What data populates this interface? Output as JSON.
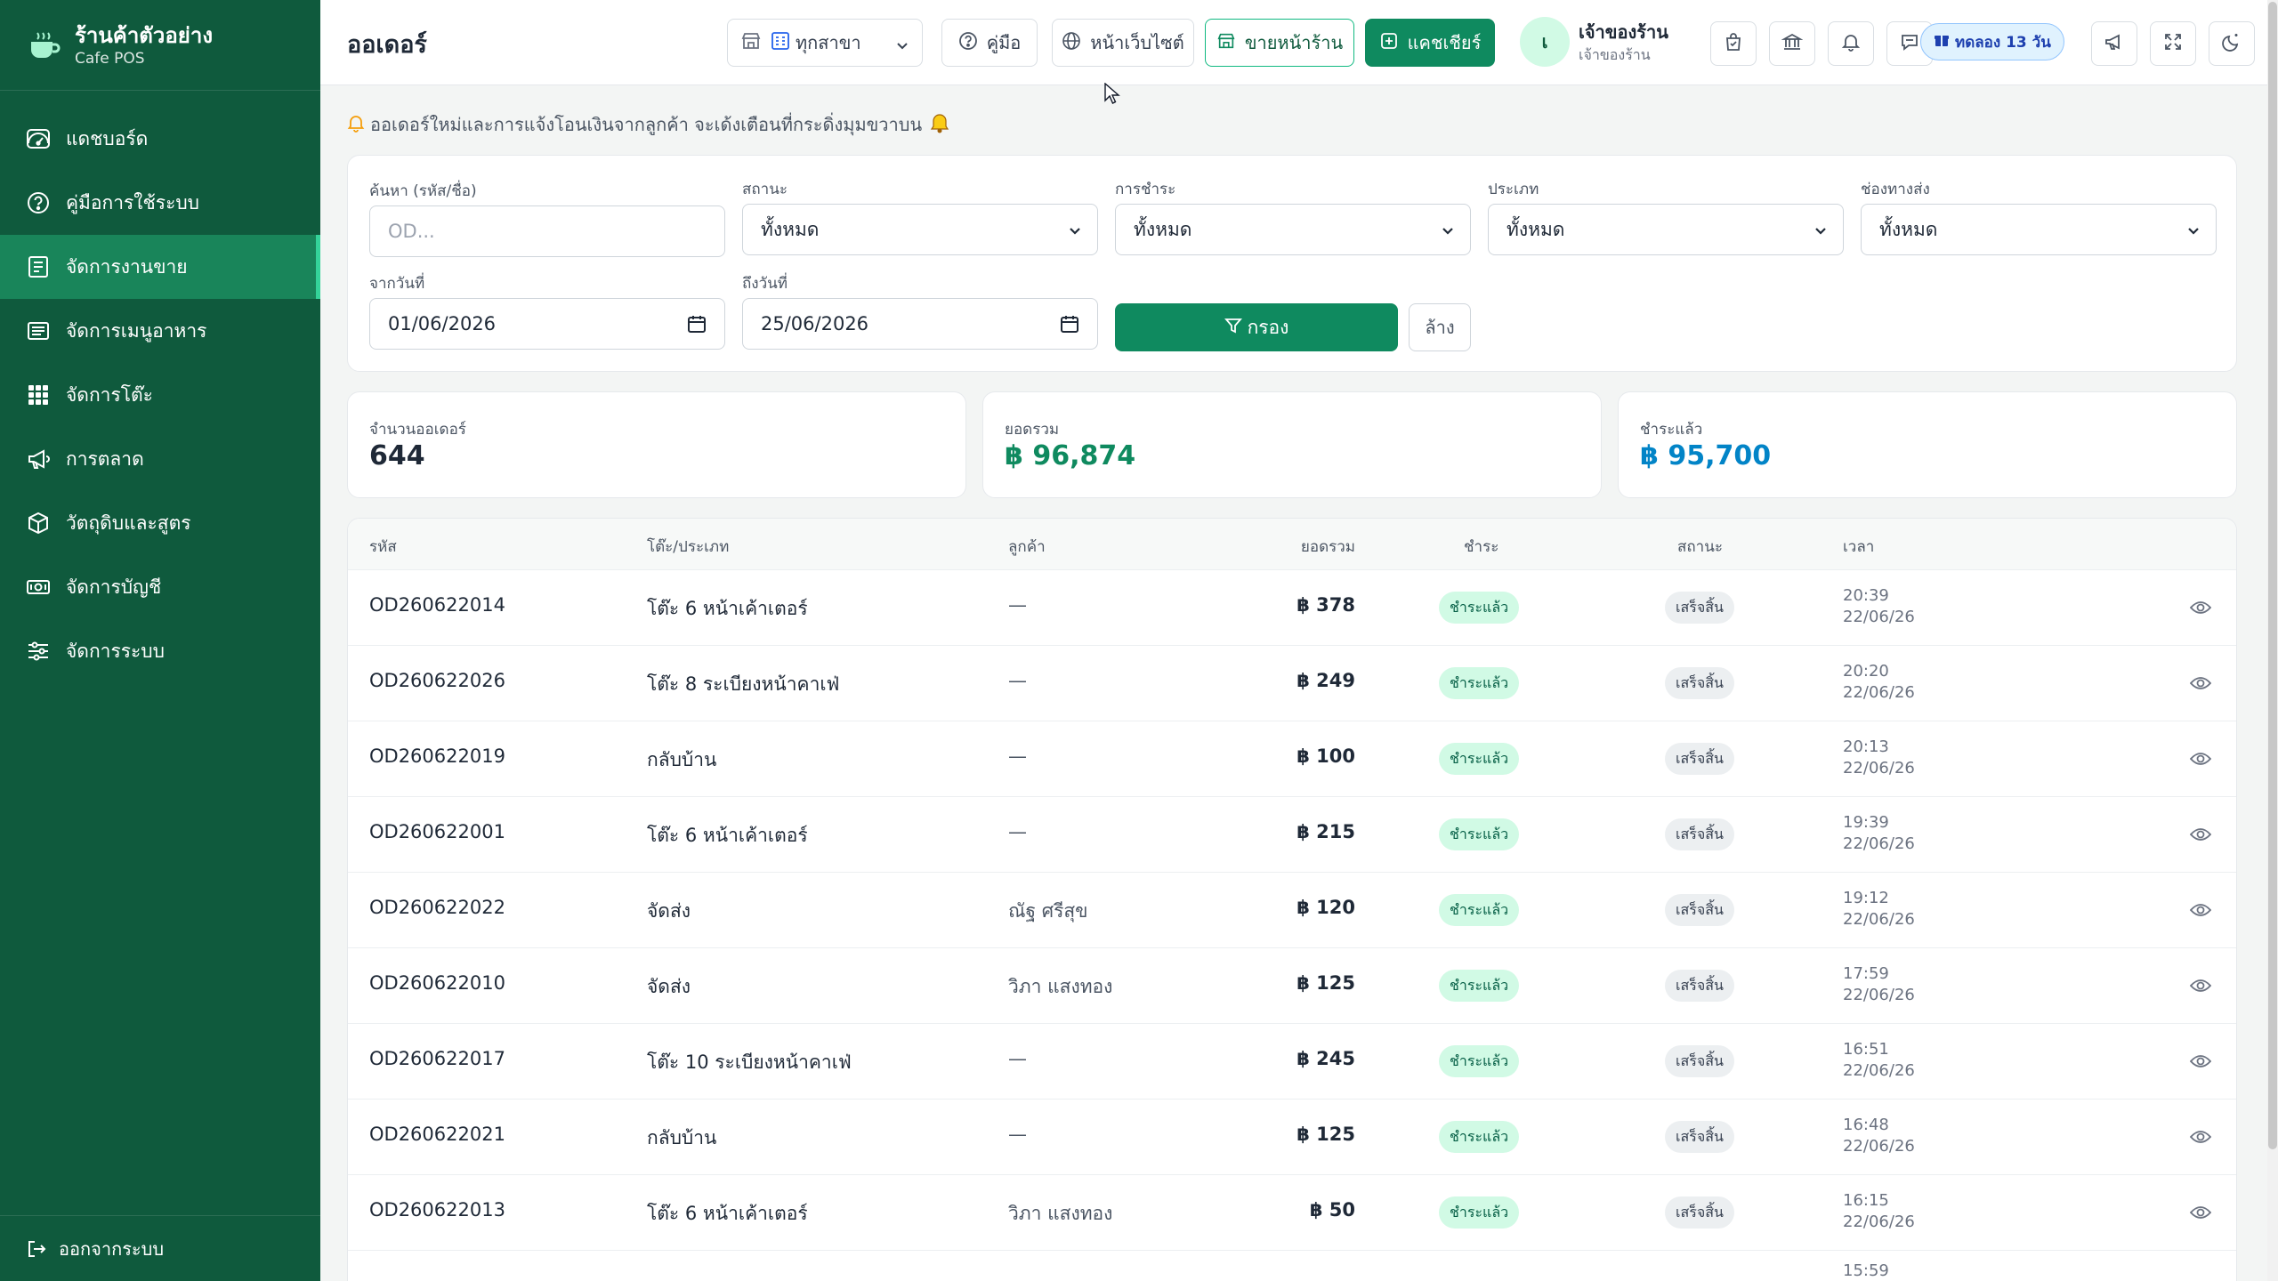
{
  "brand": {
    "title": "ร้านค้าตัวอย่าง",
    "subtitle": "Cafe POS"
  },
  "sidebar": {
    "items": [
      {
        "label": "แดชบอร์ด",
        "icon": "dashboard-icon"
      },
      {
        "label": "คู่มือการใช้ระบบ",
        "icon": "help-icon"
      },
      {
        "label": "จัดการงานขาย",
        "icon": "receipt-icon",
        "active": true
      },
      {
        "label": "จัดการเมนูอาหาร",
        "icon": "menu-list-icon"
      },
      {
        "label": "จัดการโต๊ะ",
        "icon": "grid-icon"
      },
      {
        "label": "การตลาด",
        "icon": "megaphone-icon"
      },
      {
        "label": "วัตถุดิบและสูตร",
        "icon": "box-icon"
      },
      {
        "label": "จัดการบัญชี",
        "icon": "money-icon"
      },
      {
        "label": "จัดการระบบ",
        "icon": "settings-sliders-icon"
      }
    ],
    "logout_label": "ออกจากระบบ"
  },
  "header": {
    "title": "ออเดอร์",
    "branch_select": "ทุกสาขา",
    "manual_label": "คู่มือ",
    "website_label": "หน้าเว็บไซต์",
    "storefront_label": "ขายหน้าร้าน",
    "cashier_label": "แคชเชียร์",
    "user_initial": "เ",
    "user_name": "เจ้าของร้าน",
    "user_role": "เจ้าของร้าน",
    "trial_label": "ทดลอง 13 วัน"
  },
  "notice": "ออเดอร์ใหม่และการแจ้งโอนเงินจากลูกค้า จะเด้งเตือนที่กระดิ่งมุมขวาบน",
  "filters": {
    "search_label": "ค้นหา (รหัส/ชื่อ)",
    "search_placeholder": "OD...",
    "status_label": "สถานะ",
    "status_value": "ทั้งหมด",
    "payment_label": "การชำระ",
    "payment_value": "ทั้งหมด",
    "type_label": "ประเภท",
    "type_value": "ทั้งหมด",
    "channel_label": "ช่องทางส่ง",
    "channel_value": "ทั้งหมด",
    "from_label": "จากวันที่",
    "from_value": "01/06/2026",
    "to_label": "ถึงวันที่",
    "to_value": "25/06/2026",
    "filter_button": "กรอง",
    "clear_button": "ล้าง"
  },
  "stats": {
    "orders_label": "จำนวนออเดอร์",
    "orders_value": "644",
    "total_label": "ยอดรวม",
    "total_value": "฿ 96,874",
    "paid_label": "ชำระแล้ว",
    "paid_value": "฿ 95,700"
  },
  "table": {
    "headers": {
      "code": "รหัส",
      "table": "โต๊ะ/ประเภท",
      "customer": "ลูกค้า",
      "total": "ยอดรวม",
      "payment": "ชำระ",
      "status": "สถานะ",
      "time": "เวลา"
    },
    "rows": [
      {
        "code": "OD260622014",
        "table": "โต๊ะ 6 หน้าเค้าเตอร์",
        "customer": "—",
        "total": "฿ 378",
        "payment": "ชำระแล้ว",
        "status": "เสร็จสิ้น",
        "time": "20:39",
        "date": "22/06/26"
      },
      {
        "code": "OD260622026",
        "table": "โต๊ะ 8 ระเบียงหน้าคาเฟ่",
        "customer": "—",
        "total": "฿ 249",
        "payment": "ชำระแล้ว",
        "status": "เสร็จสิ้น",
        "time": "20:20",
        "date": "22/06/26"
      },
      {
        "code": "OD260622019",
        "table": "กลับบ้าน",
        "customer": "—",
        "total": "฿ 100",
        "payment": "ชำระแล้ว",
        "status": "เสร็จสิ้น",
        "time": "20:13",
        "date": "22/06/26"
      },
      {
        "code": "OD260622001",
        "table": "โต๊ะ 6 หน้าเค้าเตอร์",
        "customer": "—",
        "total": "฿ 215",
        "payment": "ชำระแล้ว",
        "status": "เสร็จสิ้น",
        "time": "19:39",
        "date": "22/06/26"
      },
      {
        "code": "OD260622022",
        "table": "จัดส่ง",
        "customer": "ณัฐ ศรีสุข",
        "total": "฿ 120",
        "payment": "ชำระแล้ว",
        "status": "เสร็จสิ้น",
        "time": "19:12",
        "date": "22/06/26"
      },
      {
        "code": "OD260622010",
        "table": "จัดส่ง",
        "customer": "วิภา แสงทอง",
        "total": "฿ 125",
        "payment": "ชำระแล้ว",
        "status": "เสร็จสิ้น",
        "time": "17:59",
        "date": "22/06/26"
      },
      {
        "code": "OD260622017",
        "table": "โต๊ะ 10 ระเบียงหน้าคาเฟ่",
        "customer": "—",
        "total": "฿ 245",
        "payment": "ชำระแล้ว",
        "status": "เสร็จสิ้น",
        "time": "16:51",
        "date": "22/06/26"
      },
      {
        "code": "OD260622021",
        "table": "กลับบ้าน",
        "customer": "—",
        "total": "฿ 125",
        "payment": "ชำระแล้ว",
        "status": "เสร็จสิ้น",
        "time": "16:48",
        "date": "22/06/26"
      },
      {
        "code": "OD260622013",
        "table": "โต๊ะ 6 หน้าเค้าเตอร์",
        "customer": "วิภา แสงทอง",
        "total": "฿ 50",
        "payment": "ชำระแล้ว",
        "status": "เสร็จสิ้น",
        "time": "16:15",
        "date": "22/06/26"
      }
    ],
    "partial_row_time": "15:59"
  },
  "colors": {
    "sidebar": "#0f5a3d",
    "active": "#19855a",
    "accent": "#0f8a5f",
    "paid_text": "#0f8a5f",
    "badge_paid": "#d1fae5"
  }
}
